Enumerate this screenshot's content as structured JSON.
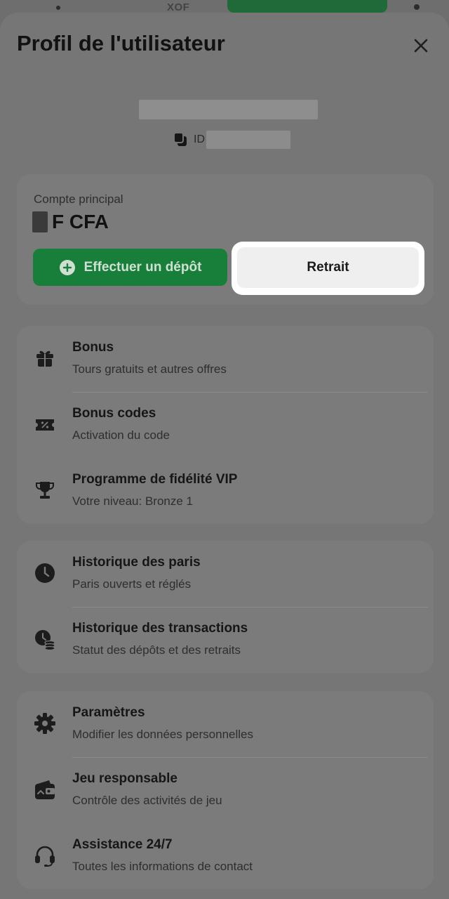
{
  "header": {
    "currency_code": "XOF"
  },
  "profile": {
    "title": "Profil de l'utilisateur",
    "id_label": "ID"
  },
  "account": {
    "label": "Compte principal",
    "currency": "F CFA",
    "deposit_label": "Effectuer un dépôt",
    "withdraw_label": "Retrait"
  },
  "groups": [
    {
      "items": [
        {
          "title": "Bonus",
          "subtitle": "Tours gratuits et autres offres",
          "icon": "gift-icon"
        },
        {
          "title": "Bonus codes",
          "subtitle": "Activation du code",
          "icon": "coupon-icon"
        },
        {
          "title": "Programme de fidélité VIP",
          "subtitle": "Votre niveau: Bronze 1",
          "icon": "trophy-icon"
        }
      ]
    },
    {
      "items": [
        {
          "title": "Historique des paris",
          "subtitle": "Paris ouverts et réglés",
          "icon": "clock-icon"
        },
        {
          "title": "Historique des transactions",
          "subtitle": "Statut des dépôts et des retraits",
          "icon": "transaction-history-icon"
        }
      ]
    },
    {
      "items": [
        {
          "title": "Paramètres",
          "subtitle": "Modifier les données personnelles",
          "icon": "gear-icon"
        },
        {
          "title": "Jeu responsable",
          "subtitle": "Contrôle des activités de jeu",
          "icon": "wallet-icon"
        },
        {
          "title": "Assistance 24/7",
          "subtitle": "Toutes les informations de contact",
          "icon": "headset-icon"
        }
      ]
    }
  ],
  "colors": {
    "overlay": "#767676",
    "deposit_green": "#177f39",
    "highlight": "#ffffff"
  }
}
